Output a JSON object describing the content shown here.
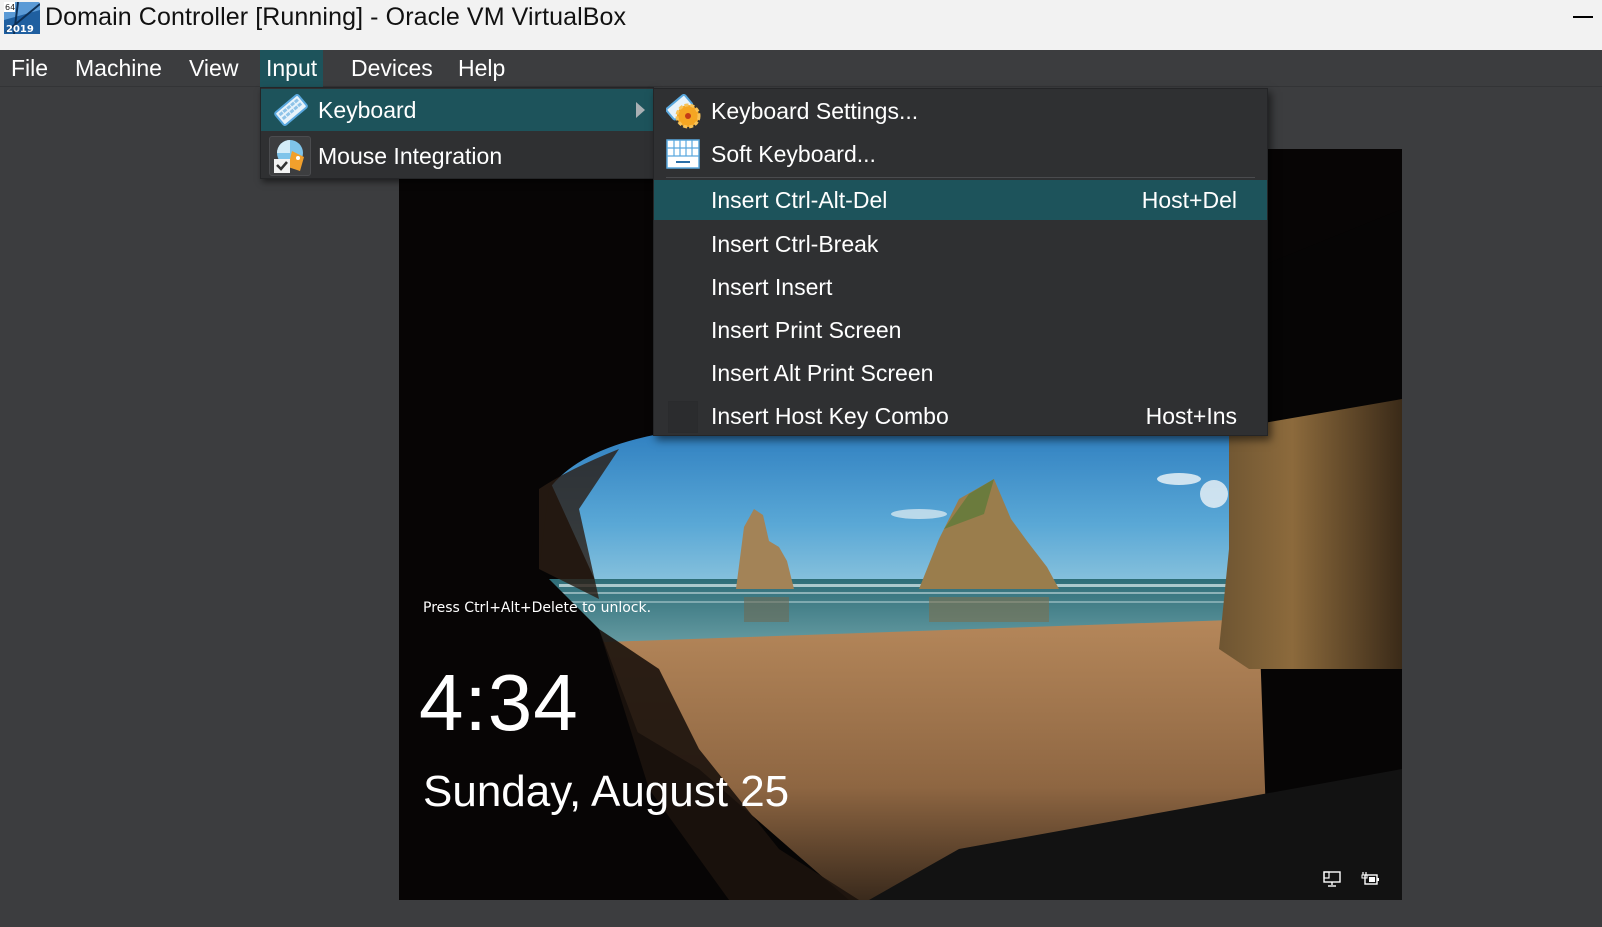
{
  "window": {
    "title": "Domain Controller [Running] - Oracle VM VirtualBox",
    "app_icon": "vm-os-icon",
    "app_icon_badge_top": "64",
    "app_icon_badge_bottom": "2019",
    "minimize_icon": "minimize-icon"
  },
  "menubar": {
    "items": [
      {
        "label": "File"
      },
      {
        "label": "Machine"
      },
      {
        "label": "View"
      },
      {
        "label": "Input",
        "open": true
      },
      {
        "label": "Devices"
      },
      {
        "label": "Help"
      }
    ]
  },
  "input_menu": {
    "items": [
      {
        "label": "Keyboard",
        "icon": "keyboard-icon",
        "has_submenu": true,
        "highlighted": true
      },
      {
        "label": "Mouse Integration",
        "icon": "mouse-integration-icon",
        "checkable": true
      }
    ]
  },
  "keyboard_submenu": {
    "items": [
      {
        "label": "Keyboard Settings...",
        "icon": "keyboard-settings-icon"
      },
      {
        "label": "Soft Keyboard...",
        "icon": "soft-keyboard-icon"
      },
      {
        "separator": true
      },
      {
        "label": "Insert Ctrl-Alt-Del",
        "shortcut": "Host+Del",
        "highlighted": true
      },
      {
        "label": "Insert Ctrl-Break",
        "shortcut": ""
      },
      {
        "label": "Insert Insert",
        "shortcut": ""
      },
      {
        "label": "Insert Print Screen",
        "shortcut": ""
      },
      {
        "label": "Insert Alt Print Screen",
        "shortcut": ""
      },
      {
        "label": "Insert Host Key Combo",
        "shortcut": "Host+Ins",
        "checkable": true,
        "checked": false
      }
    ]
  },
  "guest_screen": {
    "lock_hint": "Press Ctrl+Alt+Delete to unlock.",
    "time": "4:34",
    "date": "Sunday, August 25",
    "tray_icons": [
      "network-icon",
      "power-icon"
    ]
  },
  "colors": {
    "highlight": "#1d535b",
    "menu_bg": "#2f3032",
    "menubar_bg": "#3c3d3f",
    "titlebar_bg": "#f2f2f2"
  }
}
